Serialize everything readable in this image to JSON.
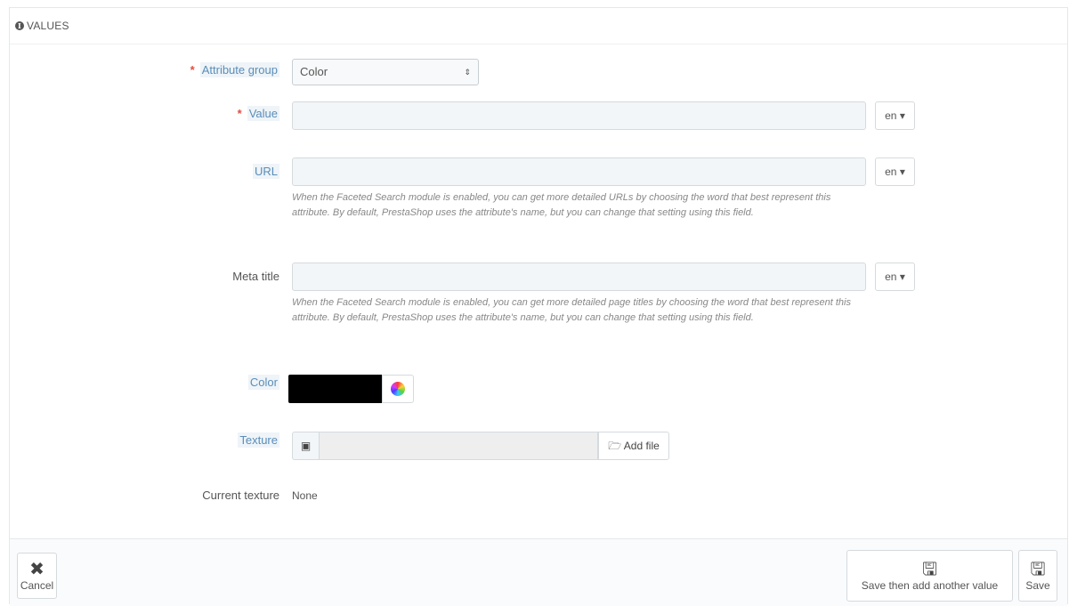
{
  "panel": {
    "heading": "VALUES"
  },
  "form": {
    "attribute_group": {
      "label": "Attribute group",
      "required_mark": "*",
      "value": "Color"
    },
    "value": {
      "label": "Value",
      "required_mark": "*",
      "input_value": "",
      "lang": "en"
    },
    "url": {
      "label": "URL",
      "input_value": "",
      "lang": "en",
      "help": "When the Faceted Search module is enabled, you can get more detailed URLs by choosing the word that best represent this attribute. By default, PrestaShop uses the attribute's name, but you can change that setting using this field."
    },
    "meta_title": {
      "label": "Meta title",
      "input_value": "",
      "lang": "en",
      "help": "When the Faceted Search module is enabled, you can get more detailed page titles by choosing the word that best represent this attribute. By default, PrestaShop uses the attribute's name, but you can change that setting using this field."
    },
    "color": {
      "label": "Color",
      "swatch_color": "#000000"
    },
    "texture": {
      "label": "Texture",
      "add_file_label": "Add file"
    },
    "current_texture": {
      "label": "Current texture",
      "value": "None"
    }
  },
  "footer": {
    "cancel_label": "Cancel",
    "save_add_label": "Save then add another value",
    "save_label": "Save"
  },
  "icons": {
    "info": "info-circle-icon",
    "caret": "select-caret-icon",
    "color_wheel": "color-wheel-icon",
    "file": "file-icon",
    "folder": "folder-open-icon",
    "cancel": "close-icon",
    "save": "floppy-disk-icon"
  }
}
